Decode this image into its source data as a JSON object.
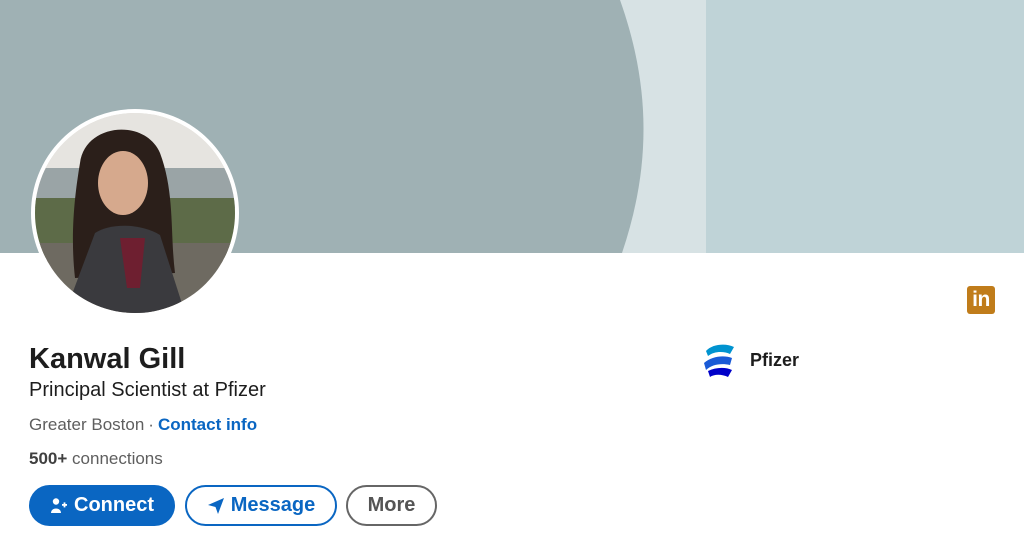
{
  "profile": {
    "name": "Kanwal Gill",
    "headline": "Principal Scientist at Pfizer",
    "location": "Greater Boston",
    "separator": "·",
    "contact_label": "Contact info",
    "connections_count": "500+",
    "connections_label": "connections"
  },
  "actions": {
    "connect_label": "Connect",
    "message_label": "Message",
    "more_label": "More"
  },
  "company": {
    "name": "Pfizer",
    "logo_icon": "pfizer-logo-icon"
  },
  "badge": {
    "text": "in",
    "icon": "linkedin-icon"
  },
  "colors": {
    "accent": "#0a66c2",
    "banner_dark": "#9fb1b4",
    "banner_light": "#bfd3d7",
    "badge": "#c07c1a"
  }
}
